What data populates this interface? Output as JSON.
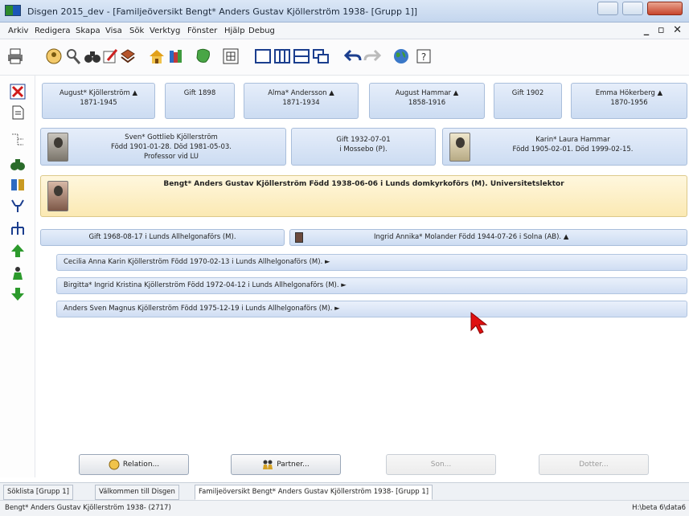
{
  "window": {
    "title": "Disgen 2015_dev - [Familjeöversikt Bengt* Anders Gustav Kjöllerström 1938- [Grupp 1]]"
  },
  "menu": [
    "Arkiv",
    "Redigera",
    "Skapa",
    "Visa",
    "Sök",
    "Verktyg",
    "Fönster",
    "Hjälp",
    "Debug"
  ],
  "mdi_controls": "_ ▫ ✕",
  "grandparents": [
    {
      "name": "August* Kjöllerström ▲",
      "years": "1871-1945"
    },
    {
      "marriage": "Gift 1898"
    },
    {
      "name": "Alma* Andersson ▲",
      "years": "1871-1934"
    },
    {
      "name": "August Hammar ▲",
      "years": "1858-1916"
    },
    {
      "marriage": "Gift 1902"
    },
    {
      "name": "Emma Hökerberg ▲",
      "years": "1870-1956"
    }
  ],
  "parents": {
    "father": {
      "line1": "Sven* Gottlieb Kjöllerström",
      "line2": "Född 1901-01-28. Död 1981-05-03.",
      "line3": "Professor vid LU"
    },
    "marriage": {
      "line1": "Gift 1932-07-01",
      "line2": "i Mossebo (P)."
    },
    "mother": {
      "line1": "Karin* Laura Hammar",
      "line2": "Född 1905-02-01. Död 1999-02-15."
    }
  },
  "main_person": {
    "line1": "Bengt* Anders Gustav Kjöllerström",
    "line2": "Född 1938-06-06 i Lunds domkyrkoförs (M).",
    "line3": "Universitetslektor"
  },
  "spouse_row": {
    "marriage": "Gift 1968-08-17 i Lunds Allhelgonaförs (M).",
    "spouse": "Ingrid Annika* Molander Född 1944-07-26 i Solna (AB). ▲"
  },
  "children": [
    "Cecilia Anna Karin Kjöllerström Född 1970-02-13 i Lunds Allhelgonaförs (M). ►",
    "Birgitta* Ingrid Kristina Kjöllerström Född 1972-04-12 i Lunds Allhelgonaförs (M). ►",
    "Anders Sven Magnus Kjöllerström Född 1975-12-19 i Lunds Allhelgonaförs (M). ►"
  ],
  "buttons": {
    "relation": "Relation...",
    "partner": "Partner...",
    "son": "Son...",
    "dotter": "Dotter..."
  },
  "tabs": [
    "Söklista [Grupp 1]",
    "Välkommen till Disgen",
    "Familjeöversikt Bengt* Anders Gustav Kjöllerström 1938- [Grupp 1]"
  ],
  "status": {
    "left": "Bengt* Anders Gustav Kjöllerström 1938- (2717)",
    "right": "H:\\beta 6\\data6"
  },
  "colors": {
    "card_blue": "#d6e4f6",
    "main_yellow": "#fbecb8",
    "cursor_red": "#e01010"
  }
}
